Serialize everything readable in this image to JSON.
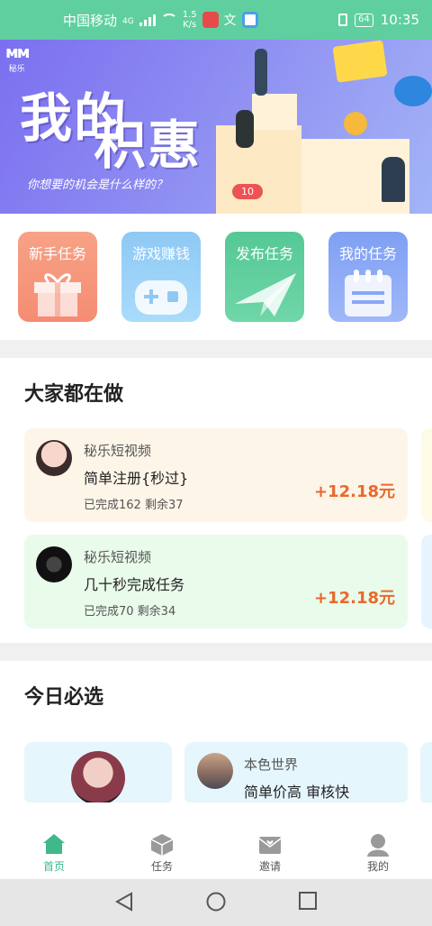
{
  "status_bar": {
    "carrier": "中国移动",
    "network": "4G",
    "net_speed_value": "1.5",
    "net_speed_unit": "K/s",
    "battery": "64",
    "time": "10:35"
  },
  "banner": {
    "logo_text": "秘乐",
    "title_line1": "我的",
    "title_line2": "积惠",
    "subtitle": "你想要的机会是什么样的？",
    "tag": "10"
  },
  "quick_actions": [
    {
      "label": "新手任务",
      "color": "#f79a7f"
    },
    {
      "label": "游戏赚钱",
      "color": "#8fcdf6"
    },
    {
      "label": "发布任务",
      "color": "#5fce9d"
    },
    {
      "label": "我的任务",
      "color": "#8aa6f5"
    }
  ],
  "popular": {
    "title": "大家都在做",
    "tasks": [
      {
        "app": "秘乐短视频",
        "name": "简单注册{秒过}",
        "meta": "已完成162 剩余37",
        "reward": "+12.18元",
        "bg": "#fdf5e8"
      },
      {
        "app": "秘乐短视频",
        "name": "几十秒完成任务",
        "meta": "已完成70 剩余34",
        "reward": "+12.18元",
        "bg": "#e9fbea"
      }
    ]
  },
  "today": {
    "title": "今日必选",
    "card2_app": "本色世界",
    "card2_name": "简单价高 审核快"
  },
  "tabs": [
    {
      "label": "首页",
      "icon": "home-icon"
    },
    {
      "label": "任务",
      "icon": "box-icon"
    },
    {
      "label": "邀请",
      "icon": "invite-icon"
    },
    {
      "label": "我的",
      "icon": "user-icon"
    }
  ],
  "colors": {
    "accent": "#3fb88a",
    "reward": "#e8692d",
    "status_bar": "#5fcf9f"
  }
}
